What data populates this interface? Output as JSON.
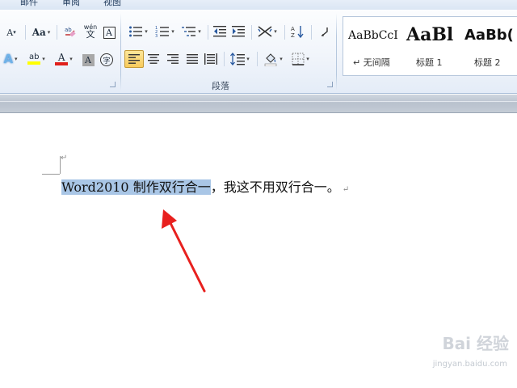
{
  "tabs": [
    "邮件",
    "审阅",
    "视图"
  ],
  "groups": {
    "paragraph_label": "段落"
  },
  "font_tools": {
    "shrink_font": "A",
    "change_case": "Aa",
    "phonetic_guide": "wén",
    "char_border": "A",
    "enclose_char": "字",
    "text_effect": "A",
    "highlight": "ab",
    "font_color": "A",
    "char_shading": "A"
  },
  "colors": {
    "highlight": "#ffff00",
    "font_color": "#e0201b",
    "selection": "#a9c6e6",
    "arrow": "#e8201e"
  },
  "styles": [
    {
      "sample": "AaBbCcI",
      "name": "↵ 无间隔"
    },
    {
      "sample": "AaBl",
      "name": "标题 1"
    },
    {
      "sample": "AaBb(",
      "name": "标题 2"
    }
  ],
  "document": {
    "empty_para_mark": "↵",
    "selected_text": "Word2010 制作双行合一",
    "rest_text": "，我这不用双行合一。",
    "para_mark": "↵"
  },
  "watermark": {
    "logo": "Bai 经验",
    "url": "jingyan.baidu.com"
  }
}
